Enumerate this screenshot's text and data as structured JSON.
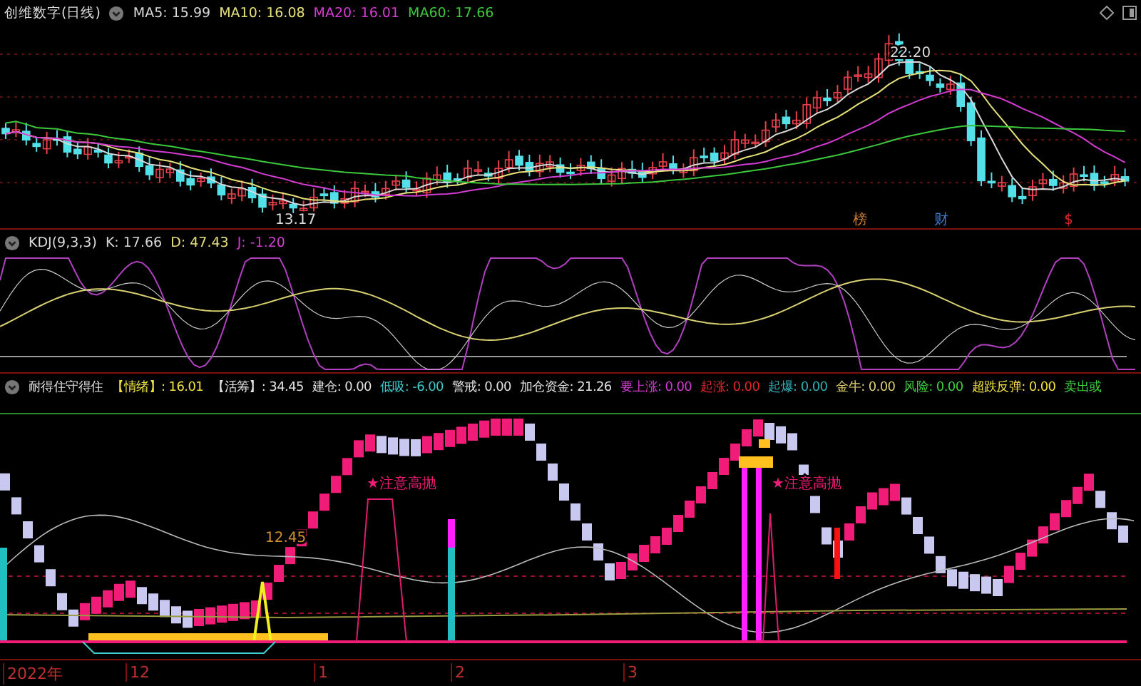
{
  "main_panel": {
    "title": "创维数字(日线)",
    "ma_readings": [
      {
        "text": "MA5: 15.99",
        "color": "#d8d8d8"
      },
      {
        "text": "MA10: 16.08",
        "color": "#e6e07a"
      },
      {
        "text": "MA20: 16.01",
        "color": "#d23cd2"
      },
      {
        "text": "MA60: 17.66",
        "color": "#3cc83c"
      }
    ],
    "high_label": "22.20",
    "low_label": "13.17",
    "event_tags": [
      {
        "text": "榜",
        "color": "#c87832"
      },
      {
        "text": "财",
        "color": "#3c78c8"
      },
      {
        "text": "$",
        "color": "#e02828"
      }
    ]
  },
  "kdj_panel": {
    "title": "KDJ(9,3,3)",
    "readings": [
      {
        "text": "K: 17.66",
        "color": "#d8d8d8"
      },
      {
        "text": "D: 47.43",
        "color": "#e6e07a"
      },
      {
        "text": "J: -1.20",
        "color": "#d23cd2"
      }
    ]
  },
  "indicator_panel": {
    "title": "耐得住守得住",
    "readings": [
      {
        "text": "【情绪】: 16.01",
        "color": "#f0e040"
      },
      {
        "text": "【活筹】: 34.45",
        "color": "#e0e0e0"
      },
      {
        "text": "建仓: 0.00",
        "color": "#e0e0e0"
      },
      {
        "text": "低吸: -6.00",
        "color": "#40c8c8"
      },
      {
        "text": "警戒: 0.00",
        "color": "#e0e0e0"
      },
      {
        "text": "加仓资金: 21.26",
        "color": "#e0e0e0"
      },
      {
        "text": "要上涨: 0.00",
        "color": "#d23cd2"
      },
      {
        "text": "起涨: 0.00",
        "color": "#e02828"
      },
      {
        "text": "起爆: 0.00",
        "color": "#30b0b8"
      },
      {
        "text": "金牛: 0.00",
        "color": "#e0d070"
      },
      {
        "text": "风险: 0.00",
        "color": "#40d040"
      },
      {
        "text": "超跌反弹: 0.00",
        "color": "#f0e040"
      },
      {
        "text": "卖出或",
        "color": "#40d040"
      }
    ],
    "value_label": "12.45",
    "alert_labels": [
      "★注意高抛",
      "★注意高抛"
    ]
  },
  "time_axis": [
    "2022年",
    "12",
    "1",
    "2",
    "3"
  ]
}
